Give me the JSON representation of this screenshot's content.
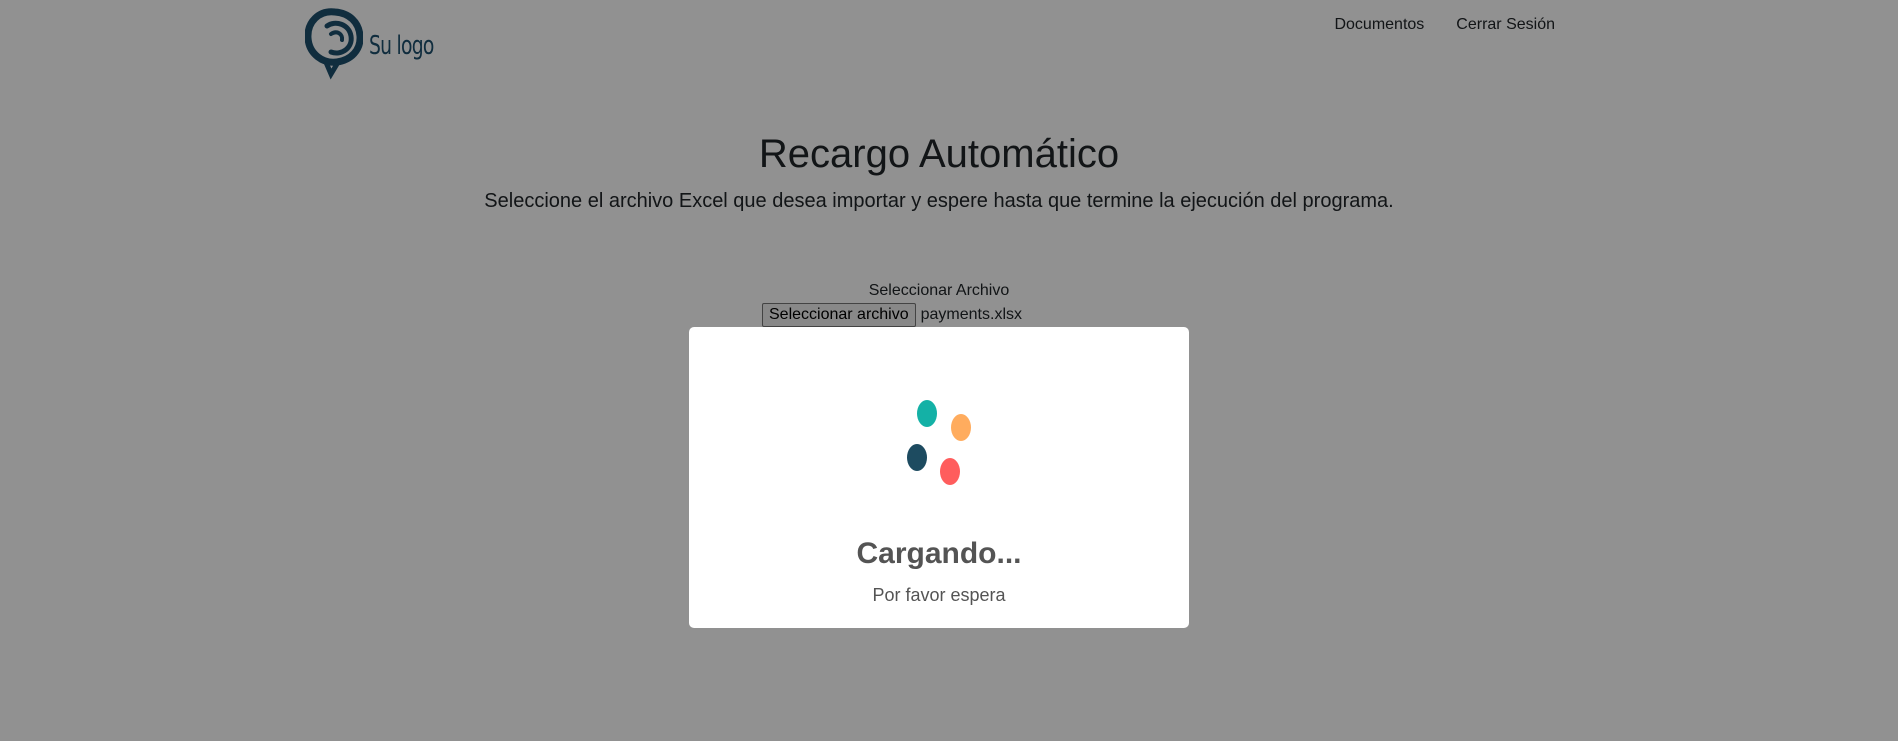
{
  "header": {
    "logo_text": "Su logo",
    "logo_color": "#1d4f6e",
    "nav": [
      {
        "label": "Documentos"
      },
      {
        "label": "Cerrar Sesión"
      }
    ]
  },
  "main": {
    "title": "Recargo Automático",
    "subtitle": "Seleccione el archivo Excel que desea importar y espere hasta que termine la ejecución del programa.",
    "file_label": "Seleccionar Archivo",
    "file_button": "Seleccionar archivo",
    "file_name": "payments.xlsx"
  },
  "modal": {
    "title": "Cargando...",
    "text": "Por favor espera",
    "dot_colors": [
      "#14b1a6",
      "#ffac5e",
      "#1d4b60",
      "#ff5d5d"
    ]
  },
  "colors": {
    "overlay": "rgba(0,0,0,0.43)",
    "modal_text": "#545454"
  }
}
